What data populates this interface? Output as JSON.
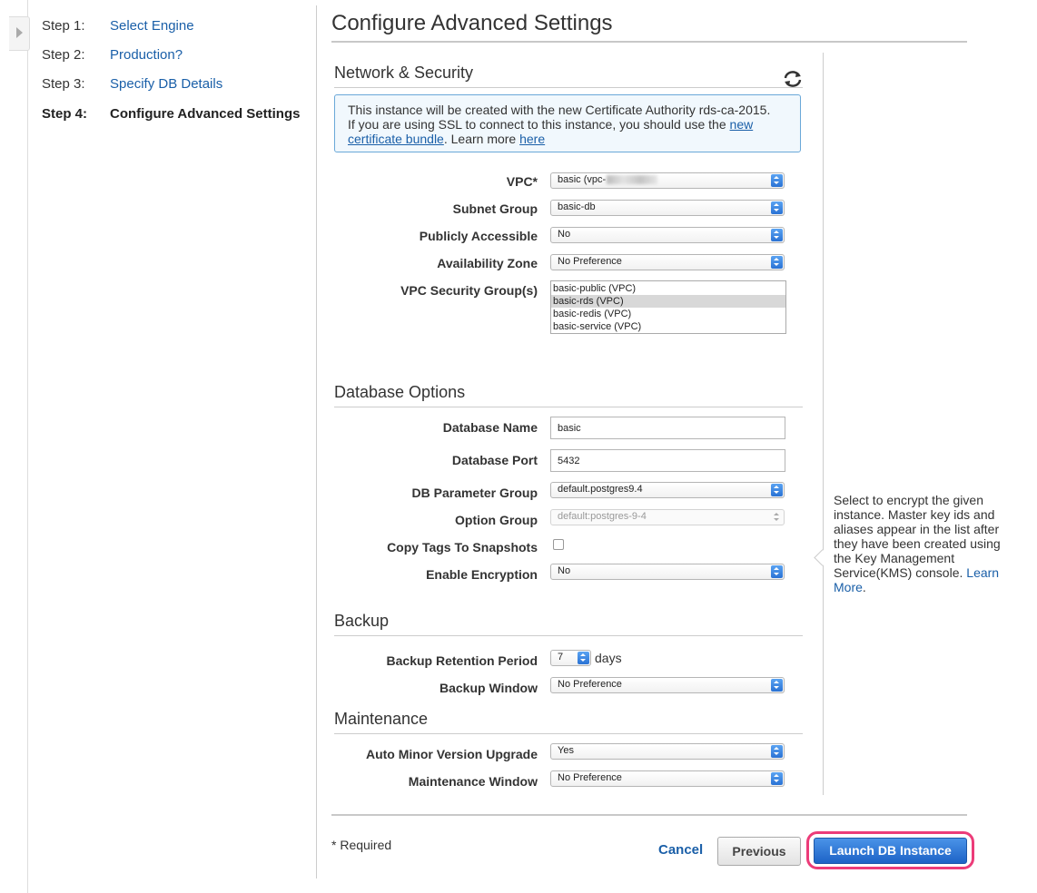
{
  "steps": [
    {
      "num": "Step 1:",
      "label": "Select Engine"
    },
    {
      "num": "Step 2:",
      "label": "Production?"
    },
    {
      "num": "Step 3:",
      "label": "Specify DB Details"
    },
    {
      "num": "Step 4:",
      "label": "Configure Advanced Settings"
    }
  ],
  "page_title": "Configure Advanced Settings",
  "network": {
    "title": "Network & Security",
    "refresh_icon": "refresh-icon",
    "info": {
      "line1": "This instance will be created with the new Certificate Authority rds-ca-2015.",
      "line2_pre": "If you are using SSL to connect to this instance, you should use the ",
      "link_new": "new",
      "link_bundle": "certificate bundle",
      "line3_mid": ". Learn more ",
      "link_here": "here"
    },
    "vpc": {
      "label": "VPC*",
      "value": "basic (vpc-"
    },
    "subnet": {
      "label": "Subnet Group",
      "value": "basic-db"
    },
    "public": {
      "label": "Publicly Accessible",
      "value": "No"
    },
    "az": {
      "label": "Availability Zone",
      "value": "No Preference"
    },
    "sg": {
      "label": "VPC Security Group(s)",
      "options": [
        "basic-public (VPC)",
        "basic-rds (VPC)",
        "basic-redis (VPC)",
        "basic-service (VPC)"
      ],
      "selected": "basic-rds (VPC)"
    }
  },
  "dbopts": {
    "title": "Database Options",
    "name": {
      "label": "Database Name",
      "value": "basic"
    },
    "port": {
      "label": "Database Port",
      "value": "5432"
    },
    "param": {
      "label": "DB Parameter Group",
      "value": "default.postgres9.4"
    },
    "option": {
      "label": "Option Group",
      "value": "default:postgres-9-4"
    },
    "copy_tags": {
      "label": "Copy Tags To Snapshots",
      "checked": false
    },
    "encryption": {
      "label": "Enable Encryption",
      "value": "No"
    }
  },
  "backup": {
    "title": "Backup",
    "retention": {
      "label": "Backup Retention Period",
      "value": "7",
      "unit": "days"
    },
    "window": {
      "label": "Backup Window",
      "value": "No Preference"
    }
  },
  "maintenance": {
    "title": "Maintenance",
    "auto_minor": {
      "label": "Auto Minor Version Upgrade",
      "value": "Yes"
    },
    "window": {
      "label": "Maintenance Window",
      "value": "No Preference"
    }
  },
  "help": {
    "text": "Select to encrypt the given instance. Master key ids and aliases appear in the list after they have been created using the Key Management Service(KMS) console. ",
    "link": "Learn More",
    "tail": "."
  },
  "footer": {
    "required": "* Required",
    "cancel": "Cancel",
    "previous": "Previous",
    "launch": "Launch DB Instance"
  },
  "colors": {
    "link": "#1a5fa8",
    "primary": "#1d63c6",
    "highlight_ring": "#ec3c79"
  }
}
